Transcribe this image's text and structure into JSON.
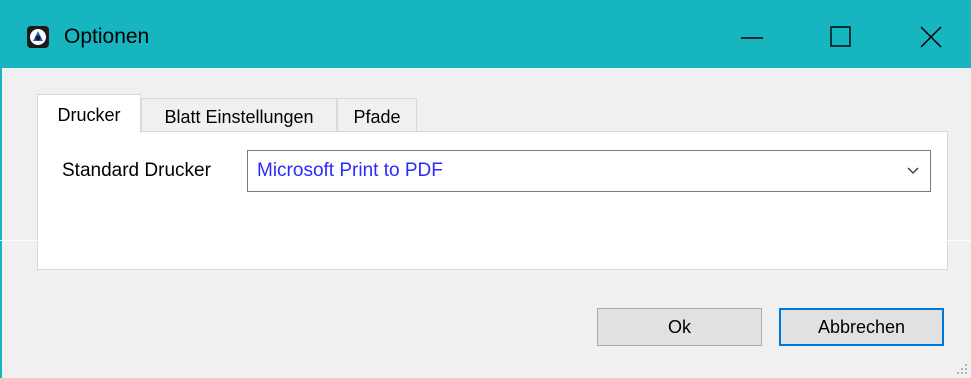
{
  "window": {
    "title": "Optionen",
    "icon": "app-icon",
    "controls": {
      "minimize": "minimize-icon",
      "maximize": "maximize-icon",
      "close": "close-icon"
    },
    "titlebar_color": "#17b5c0"
  },
  "tabs": [
    {
      "label": "Drucker",
      "active": true
    },
    {
      "label": "Blatt Einstellungen",
      "active": false
    },
    {
      "label": "Pfade",
      "active": false
    }
  ],
  "drucker_tab": {
    "printer_label": "Standard Drucker",
    "printer_value": "Microsoft Print to PDF",
    "value_color": "#2a2aff"
  },
  "buttons": {
    "ok_label": "Ok",
    "cancel_label": "Abbrechen"
  }
}
